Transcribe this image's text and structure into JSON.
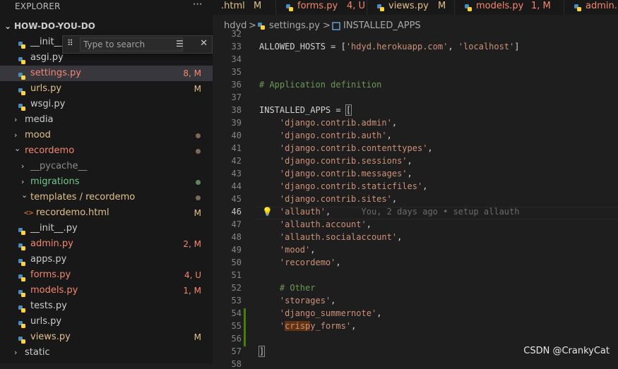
{
  "explorer": {
    "title": "EXPLORER",
    "more_icon": "ellipsis-icon",
    "root_label": "HOW-DO-YOU-DO",
    "search": {
      "placeholder": "Type to search",
      "filter_icon": "filter-icon",
      "close_icon": "close-icon"
    },
    "items": [
      {
        "label": "__init__",
        "type": "python",
        "status": "",
        "color": "def",
        "indent": 2
      },
      {
        "label": "asgi.py",
        "type": "python",
        "status": "",
        "color": "def",
        "indent": 2
      },
      {
        "label": "settings.py",
        "type": "python",
        "status": "8, M",
        "color": "red",
        "indent": 2,
        "selected": true
      },
      {
        "label": "urls.py",
        "type": "python",
        "status": "M",
        "color": "yellow",
        "indent": 2
      },
      {
        "label": "wsgi.py",
        "type": "python",
        "status": "",
        "color": "def",
        "indent": 2
      },
      {
        "label": "media",
        "type": "folder-closed",
        "status": "",
        "color": "def",
        "indent": 1
      },
      {
        "label": "mood",
        "type": "folder-closed",
        "status": "dot",
        "color": "yellow",
        "indent": 1
      },
      {
        "label": "recordemo",
        "type": "folder-open",
        "status": "dot",
        "color": "red",
        "indent": 1
      },
      {
        "label": "__pycache__",
        "type": "folder-closed",
        "status": "",
        "color": "grey",
        "indent": 2
      },
      {
        "label": "migrations",
        "type": "folder-closed",
        "status": "dot",
        "color": "green",
        "indent": 2
      },
      {
        "label": "templates / recordemo",
        "type": "folder-open",
        "status": "dot",
        "color": "yellow",
        "indent": 2
      },
      {
        "label": "recordemo.html",
        "type": "html",
        "status": "M",
        "color": "yellow",
        "indent": 3
      },
      {
        "label": "__init__.py",
        "type": "python",
        "status": "",
        "color": "def",
        "indent": 2
      },
      {
        "label": "admin.py",
        "type": "python",
        "status": "2, M",
        "color": "red",
        "indent": 2
      },
      {
        "label": "apps.py",
        "type": "python",
        "status": "",
        "color": "def",
        "indent": 2
      },
      {
        "label": "forms.py",
        "type": "python",
        "status": "4, U",
        "color": "red",
        "indent": 2
      },
      {
        "label": "models.py",
        "type": "python",
        "status": "1, M",
        "color": "red",
        "indent": 2
      },
      {
        "label": "tests.py",
        "type": "python",
        "status": "",
        "color": "def",
        "indent": 2
      },
      {
        "label": "urls.py",
        "type": "python",
        "status": "",
        "color": "def",
        "indent": 2
      },
      {
        "label": "views.py",
        "type": "python",
        "status": "M",
        "color": "yellow",
        "indent": 2
      },
      {
        "label": "static",
        "type": "folder-closed",
        "status": "",
        "color": "def",
        "indent": 1
      }
    ]
  },
  "tabs": [
    {
      "label": ".html",
      "status": "M",
      "color": "yellow",
      "icon": ""
    },
    {
      "label": "forms.py",
      "status": "4, U",
      "color": "red",
      "icon": "python-icon"
    },
    {
      "label": "views.py",
      "status": "M",
      "color": "yellow",
      "icon": "python-icon"
    },
    {
      "label": "models.py",
      "status": "1, M",
      "color": "red",
      "icon": "python-icon"
    },
    {
      "label": "admin.",
      "status": "",
      "color": "red",
      "icon": "python-icon"
    }
  ],
  "breadcrumbs": [
    "hdyd",
    ">",
    "settings.py",
    ">",
    "INSTALLED_APPS"
  ],
  "code": [
    {
      "n": "32",
      "parts": []
    },
    {
      "n": "33",
      "parts": [
        [
          "kw",
          "ALLOWED_HOSTS = ["
        ],
        [
          "str",
          "'hdyd.herokuapp.com'"
        ],
        [
          "kw",
          ", "
        ],
        [
          "str",
          "'localhost'"
        ],
        [
          "kw",
          "]"
        ]
      ]
    },
    {
      "n": "34",
      "parts": []
    },
    {
      "n": "35",
      "parts": []
    },
    {
      "n": "36",
      "parts": [
        [
          "cmt",
          "# Application definition"
        ]
      ]
    },
    {
      "n": "37",
      "parts": []
    },
    {
      "n": "38",
      "parts": [
        [
          "kw",
          "INSTALLED_APPS = "
        ],
        [
          "kw",
          "["
        ]
      ]
    },
    {
      "n": "39",
      "parts": [
        [
          "kw",
          "    "
        ],
        [
          "str",
          "'django.contrib.admin'"
        ],
        [
          "kw",
          ","
        ]
      ]
    },
    {
      "n": "40",
      "parts": [
        [
          "kw",
          "    "
        ],
        [
          "str",
          "'django.contrib.auth'"
        ],
        [
          "kw",
          ","
        ]
      ]
    },
    {
      "n": "41",
      "parts": [
        [
          "kw",
          "    "
        ],
        [
          "str",
          "'django.contrib.contenttypes'"
        ],
        [
          "kw",
          ","
        ]
      ]
    },
    {
      "n": "42",
      "parts": [
        [
          "kw",
          "    "
        ],
        [
          "str",
          "'django.contrib.sessions'"
        ],
        [
          "kw",
          ","
        ]
      ]
    },
    {
      "n": "43",
      "parts": [
        [
          "kw",
          "    "
        ],
        [
          "str",
          "'django.contrib.messages'"
        ],
        [
          "kw",
          ","
        ]
      ]
    },
    {
      "n": "44",
      "parts": [
        [
          "kw",
          "    "
        ],
        [
          "str",
          "'django.contrib.staticfiles'"
        ],
        [
          "kw",
          ","
        ]
      ]
    },
    {
      "n": "45",
      "parts": [
        [
          "kw",
          "    "
        ],
        [
          "str",
          "'django.contrib.sites'"
        ],
        [
          "kw",
          ","
        ]
      ]
    },
    {
      "n": "46",
      "parts": [
        [
          "kw",
          "    "
        ],
        [
          "str",
          "'allauth'"
        ],
        [
          "kw",
          ","
        ],
        [
          "blame",
          "      You, 2 days ago • setup allauth"
        ]
      ],
      "current": true
    },
    {
      "n": "47",
      "parts": [
        [
          "kw",
          "    "
        ],
        [
          "str",
          "'allauth.account'"
        ],
        [
          "kw",
          ","
        ]
      ]
    },
    {
      "n": "48",
      "parts": [
        [
          "kw",
          "    "
        ],
        [
          "str",
          "'allauth.socialaccount'"
        ],
        [
          "kw",
          ","
        ]
      ]
    },
    {
      "n": "49",
      "parts": [
        [
          "kw",
          "    "
        ],
        [
          "str",
          "'mood'"
        ],
        [
          "kw",
          ","
        ]
      ]
    },
    {
      "n": "50",
      "parts": [
        [
          "kw",
          "    "
        ],
        [
          "str",
          "'recordemo'"
        ],
        [
          "kw",
          ","
        ]
      ]
    },
    {
      "n": "51",
      "parts": []
    },
    {
      "n": "52",
      "parts": [
        [
          "kw",
          "    "
        ],
        [
          "cmt",
          "# Other"
        ]
      ]
    },
    {
      "n": "53",
      "parts": [
        [
          "kw",
          "    "
        ],
        [
          "str",
          "'storages'"
        ],
        [
          "kw",
          ","
        ]
      ]
    },
    {
      "n": "54",
      "parts": [
        [
          "kw",
          "    "
        ],
        [
          "str",
          "'django_summernote'"
        ],
        [
          "kw",
          ","
        ]
      ],
      "added": true
    },
    {
      "n": "55",
      "parts": [
        [
          "kw",
          "    "
        ],
        [
          "str",
          "'"
        ],
        [
          "findhl",
          "crisp"
        ],
        [
          "str",
          "y_forms'"
        ],
        [
          "kw",
          ","
        ]
      ],
      "added": true
    },
    {
      "n": "56",
      "parts": [],
      "added": true
    },
    {
      "n": "57",
      "parts": [
        [
          "kw",
          "]"
        ]
      ]
    },
    {
      "n": "58",
      "parts": []
    }
  ],
  "watermark": "CSDN @CrankyCat",
  "colors": {
    "red": "#f48771",
    "yellow": "#e2c08d",
    "green": "#73c991",
    "def": "#cccccc",
    "grey": "#8c8c8c",
    "python_blue": "#4b8bbe",
    "python_yellow": "#ffd43b",
    "added_gutter": "#487e02"
  }
}
